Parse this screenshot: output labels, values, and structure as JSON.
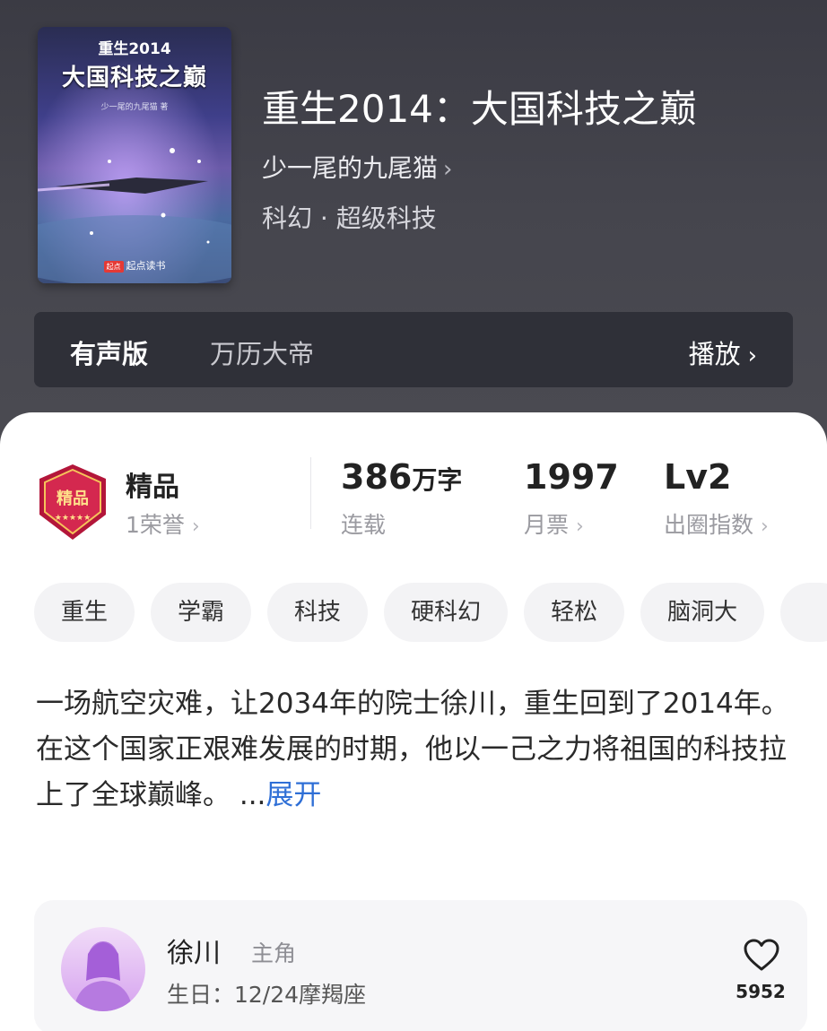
{
  "cover": {
    "subtitle": "重生2014",
    "title": "大国科技之巅",
    "author": "少一尾的九尾猫 著",
    "publisher_mark": "起点",
    "publisher": "起点读书"
  },
  "book": {
    "title": "重生2014：大国科技之巅",
    "author": "少一尾的九尾猫",
    "genre": "科幻 · 超级科技"
  },
  "audio": {
    "label": "有声版",
    "narrator": "万历大帝",
    "play_label": "播放"
  },
  "honor": {
    "badge_text": "精品",
    "title": "精品",
    "count": "1荣誉"
  },
  "stats": {
    "words_value": "386",
    "words_unit": "万字",
    "words_label": "连载",
    "tickets_value": "1997",
    "tickets_label": "月票",
    "level_value": "Lv2",
    "level_label": "出圈指数"
  },
  "tags": [
    "重生",
    "学霸",
    "科技",
    "硬科幻",
    "轻松",
    "脑洞大"
  ],
  "description": {
    "line1": "一场航空灾难，让2034年的院士徐川，重生回到了2014年。",
    "line2": "在这个国家正艰难发展的时期，他以一己之力将祖国的科技拉上了全球巅峰。 ...",
    "expand_label": "展开"
  },
  "character": {
    "name": "徐川",
    "role": "主角",
    "birthday": "生日：12/24摩羯座",
    "likes": "5952"
  },
  "colors": {
    "accent_link": "#2f6fd6",
    "hero_bg": "#45454d",
    "badge_red": "#b3163a"
  }
}
